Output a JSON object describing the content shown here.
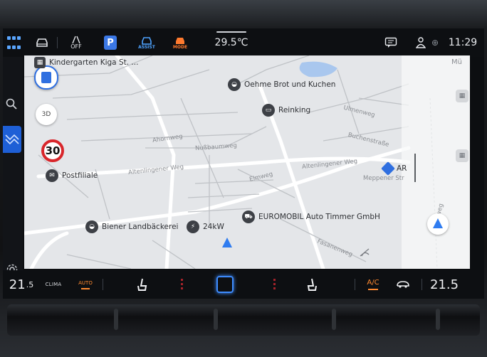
{
  "statusbar": {
    "assist_off_label": "OFF",
    "park_label": "P",
    "assist_label": "ASSIST",
    "mode_label": "MODE",
    "outside_temp": "29.5℃",
    "clock": "11:29"
  },
  "map": {
    "speed_limit": "30",
    "view_3d_label": "3D",
    "pois": {
      "kindergarten": "Kindergarten Kiga St. ...",
      "oehme": "Oehme Brot und Kuchen",
      "reinking": "Reinking",
      "postfiliale": "Postfiliale",
      "biener": "Biener Landbäckerei",
      "charger": "24kW",
      "euromobil": "EUROMOBIL Auto Timmer GmbH",
      "ar": "AR",
      "top_right": "Mü"
    },
    "streets": {
      "ahornweg": "Ahornweg",
      "nussbaumweg": "Nußbaumweg",
      "altenlingener_w": "Altenlingener Weg",
      "altenlingener_e": "Altenlingener Weg",
      "elmweg": "Elmweg",
      "ulmenweg": "Ulmenweg",
      "buchenstrasse": "Buchenstraße",
      "meppener": "Meppener Str",
      "fasanenweg": "Fasanenweg",
      "bruchweg": "Bruchweg"
    }
  },
  "climate": {
    "temp_left_int": "21",
    "temp_left_dec": ".5",
    "clima_label": "CLIMA",
    "auto_label": "AUTO",
    "ac_label": "A/C",
    "temp_right": "21.5"
  },
  "colors": {
    "accent_blue": "#3e8cff",
    "active_orange": "#ff8a30",
    "speed_sign_red": "#d8262b"
  }
}
